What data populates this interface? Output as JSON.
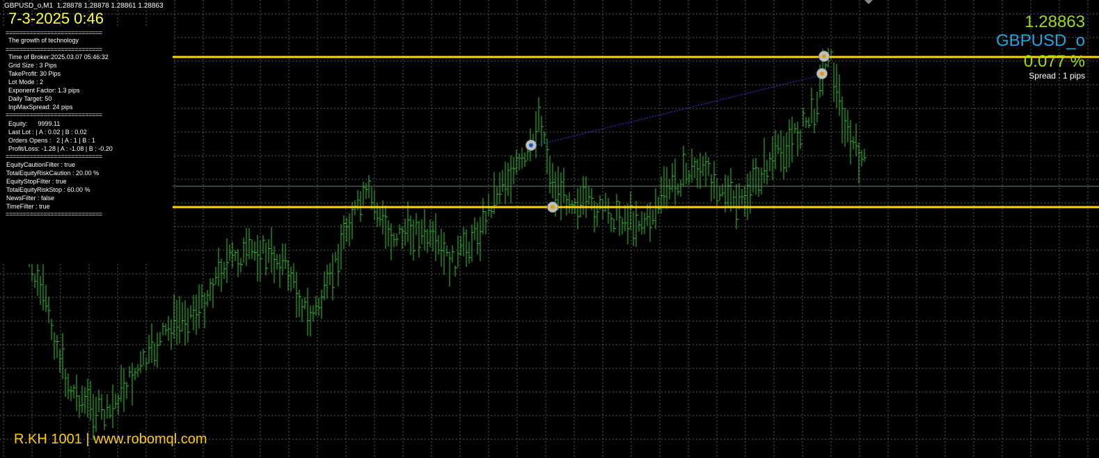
{
  "header": {
    "symbol_line": "GBPUSD_o,M1  1.28878 1.28878 1.28861 1.28863"
  },
  "clock": {
    "datetime": "7-3-2025 0:46"
  },
  "info_panel": {
    "separator": "============================",
    "title": "The growth of technology",
    "time_of_broker": "Time of Broker:2025.03.07 05:46:32",
    "grid_size": "Grid Size : 3 Pips",
    "take_profit": "TakeProfit: 30 Pips",
    "lot_mode": "Lot Mode : 2",
    "exponent_factor": "Exponent Factor: 1.3 pips",
    "daily_target": "Daily Target: 50",
    "inp_max_spread": "InpMaxSpread: 24 pips",
    "equity": "Equity:      9999.11",
    "last_lot": "Last Lot : | A : 0.02 | B : 0.02",
    "orders_opens": "Orders Opens :   2 | A : 1 | B : 1",
    "profit_loss": "Profit/Loss: -1.28 | A : -1.08 | B : -0.20",
    "equity_caution_filter": "EquityCautionFilter : true",
    "total_equity_risk_caution": "TotalEquityRiskCaution : 20.00 %",
    "equity_stop_filter": "EquityStopFilter : true",
    "total_equity_risk_stop": "TotalEquityRiskStop : 60.00 %",
    "news_filter": "NewsFilter : false",
    "time_filter": "TimeFilter : true"
  },
  "quote_panel": {
    "price": "1.28863",
    "symbol": "GBPUSD_o",
    "percent": "0.077 %",
    "spread": "Spread : 1 pips"
  },
  "footer": {
    "brand": "R.KH 1001 | www.robomql.com"
  },
  "colors": {
    "background": "#000000",
    "grid": "#5a5a5a",
    "candle": "#22cc22",
    "level_line": "#ffd400",
    "price_green": "#9ddc00",
    "symbol_blue": "#1fa6e0",
    "clock_yellow": "#ffff33",
    "footer_yellow": "#ffcc00"
  },
  "chart_data": {
    "type": "bar",
    "symbol": "GBPUSD_o",
    "timeframe": "M1",
    "last_bar": {
      "open": 1.28878,
      "high": 1.28878,
      "low": 1.28861,
      "close": 1.28863
    },
    "price_range_approx": [
      1.287,
      1.289
    ],
    "level_lines_relative": [
      0.14,
      0.48
    ],
    "grid": true
  }
}
